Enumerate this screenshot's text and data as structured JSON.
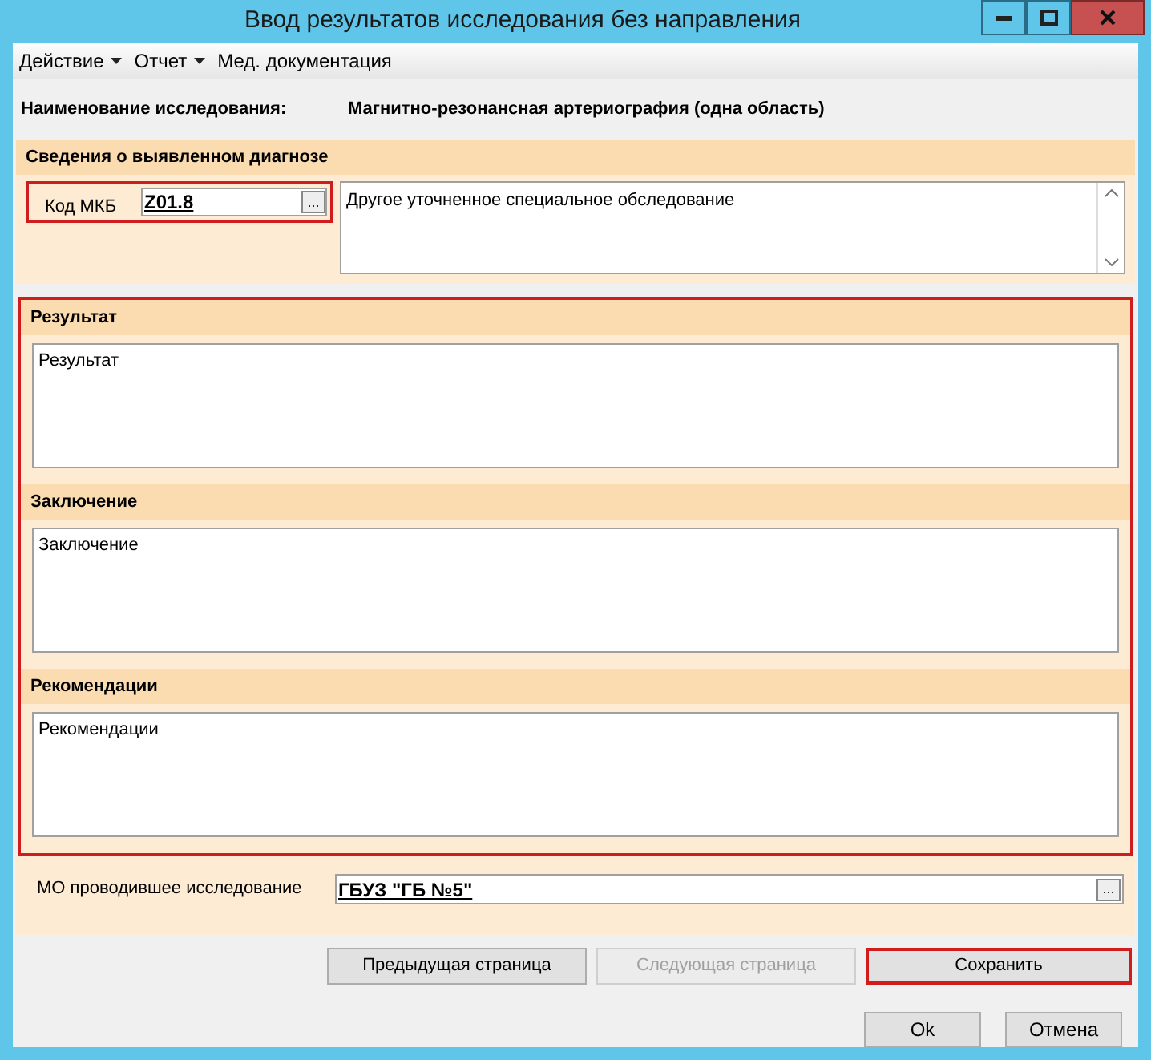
{
  "window": {
    "title": "Ввод результатов исследования без направления"
  },
  "menu": [
    {
      "label": "Действие",
      "dropdown": true
    },
    {
      "label": "Отчет",
      "dropdown": true
    },
    {
      "label": "Мед. документация",
      "dropdown": false
    }
  ],
  "study": {
    "label": "Наименование исследования:",
    "value": "Магнитно-резонансная артериография (одна область)"
  },
  "diagnosis": {
    "title": "Сведения о выявленном диагнозе",
    "code_label": "Код МКБ",
    "code": "Z01.8",
    "code_button": "...",
    "highlighted": true,
    "description": "Другое уточненное специальное обследование"
  },
  "results_highlighted": true,
  "sections": [
    {
      "title": "Результат",
      "value": "Результат"
    },
    {
      "title": "Заключение",
      "value": "Заключение"
    },
    {
      "title": "Рекомендации",
      "value": "Рекомендации"
    }
  ],
  "organization": {
    "label": "МО проводившее исследование",
    "value": "ГБУЗ \"ГБ №5\"",
    "button": "..."
  },
  "nav_buttons": [
    {
      "label": "Предыдущая страница",
      "disabled": false,
      "highlighted": false
    },
    {
      "label": "Следующая страница",
      "disabled": true,
      "highlighted": false
    },
    {
      "label": "Сохранить",
      "disabled": false,
      "highlighted": true
    }
  ],
  "dialog_buttons": [
    "Ok",
    "Отмена"
  ]
}
